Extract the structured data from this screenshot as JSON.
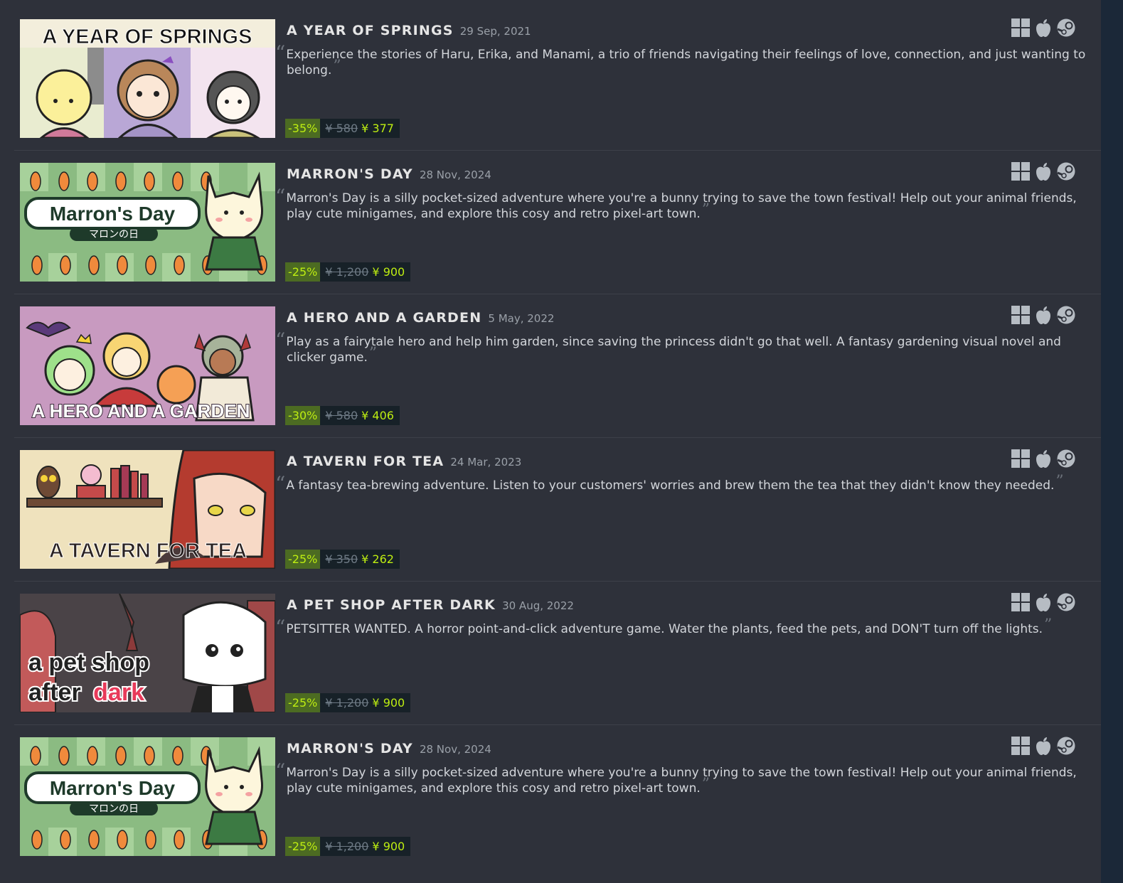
{
  "items": [
    {
      "title": "A YEAR OF SPRINGS",
      "date": "29 Sep, 2021",
      "description": "Experience the stories of Haru, Erika, and Manami, a trio of friends navigating their feelings of love, connection, and just wanting to belong.",
      "discount": "-35%",
      "original_price": "¥ 580",
      "final_price": "¥ 377",
      "capsule_text": "A YEAR OF SPRINGS"
    },
    {
      "title": "MARRON'S DAY",
      "date": "28 Nov, 2024",
      "description": "Marron's Day is a silly pocket-sized adventure where you're a bunny trying to save the town festival! Help out your animal friends, play cute minigames, and explore this cosy and retro pixel-art town.",
      "discount": "-25%",
      "original_price": "¥ 1,200",
      "final_price": "¥ 900",
      "capsule_text": "Marron's Day",
      "capsule_subtext": "マロンの日"
    },
    {
      "title": "A HERO AND A GARDEN",
      "date": "5 May, 2022",
      "description": "Play as a fairytale hero and help him garden, since saving the princess didn't go that well. A fantasy gardening visual novel and clicker game.",
      "discount": "-30%",
      "original_price": "¥ 580",
      "final_price": "¥ 406",
      "capsule_text": "A HERO AND A GARDEN"
    },
    {
      "title": "A TAVERN FOR TEA",
      "date": "24 Mar, 2023",
      "description": "A fantasy tea-brewing adventure. Listen to your customers' worries and brew them the tea that they didn't know they needed.",
      "discount": "-25%",
      "original_price": "¥ 350",
      "final_price": "¥ 262",
      "capsule_text": "A TAVERN FOR TEA"
    },
    {
      "title": "A PET SHOP AFTER DARK",
      "date": "30 Aug, 2022",
      "description": "PETSITTER WANTED. A horror point-and-click adventure game. Water the plants, feed the pets, and DON'T turn off the lights.",
      "discount": "-25%",
      "original_price": "¥ 1,200",
      "final_price": "¥ 900",
      "capsule_text_1": "a pet shop",
      "capsule_text_2": "after",
      "capsule_text_3": "dark"
    },
    {
      "title": "MARRON'S DAY",
      "date": "28 Nov, 2024",
      "description": "Marron's Day is a silly pocket-sized adventure where you're a bunny trying to save the town festival! Help out your animal friends, play cute minigames, and explore this cosy and retro pixel-art town.",
      "discount": "-25%",
      "original_price": "¥ 1,200",
      "final_price": "¥ 900",
      "capsule_text": "Marron's Day",
      "capsule_subtext": "マロンの日"
    }
  ],
  "quotes": {
    "open": "“",
    "close": "”"
  },
  "platform_icons": [
    "windows-icon",
    "apple-icon",
    "steam-icon"
  ],
  "colors": {
    "background": "#2e313a",
    "discount_bg": "#4c6b22",
    "discount_text": "#beee11",
    "price_bg": "#172128"
  }
}
